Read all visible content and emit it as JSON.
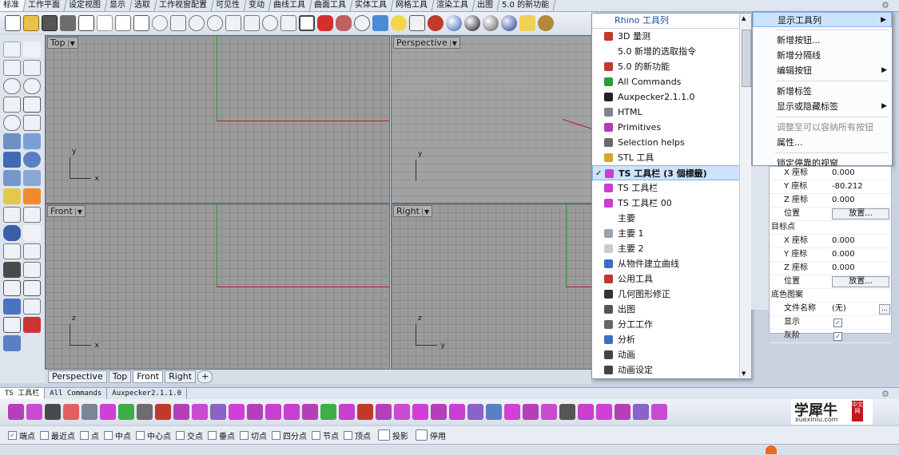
{
  "tabbar": {
    "tabs": [
      "标准",
      "工作平面",
      "设定视图",
      "显示",
      "选取",
      "工作视窗配置",
      "可见性",
      "变动",
      "曲线工具",
      "曲面工具",
      "实体工具",
      "网格工具",
      "渲染工具",
      "出图",
      "5.0 的新功能"
    ]
  },
  "viewports": {
    "top": "Top",
    "perspective": "Perspective",
    "front": "Front",
    "right": "Right",
    "axis_x": "x",
    "axis_y": "y",
    "axis_z": "z"
  },
  "viewport_tabs": [
    "Perspective",
    "Top",
    "Front",
    "Right",
    "+"
  ],
  "toolbar_list": {
    "header": "Rhino 工具列",
    "items": [
      {
        "label": "3D 量测",
        "color": "#c0392b"
      },
      {
        "label": "5.0 新增的选取指令",
        "color": ""
      },
      {
        "label": "5.0 的新功能",
        "color": "#c0392b"
      },
      {
        "label": "All Commands",
        "color": "#2e9b3b"
      },
      {
        "label": "Auxpecker2.1.1.0",
        "color": "#222222"
      },
      {
        "label": "HTML",
        "color": "#7a8597"
      },
      {
        "label": "Primitives",
        "color": "#b13ab8"
      },
      {
        "label": "Selection helps",
        "color": "#6a6a6a"
      },
      {
        "label": "STL 工具",
        "color": "#d8a431"
      },
      {
        "label": "TS 工具栏 (3 個標籤)",
        "color": "#c93fd0",
        "selected": true,
        "checked": "✓"
      },
      {
        "label": "TS 工具栏",
        "color": "#c93fd0"
      },
      {
        "label": "TS 工具栏 00",
        "color": "#c93fd0"
      },
      {
        "label": "主要",
        "color": ""
      },
      {
        "label": "主要 1",
        "color": "#9aa4b3"
      },
      {
        "label": "主要 2",
        "color": "#c8ccd3"
      },
      {
        "label": "从物件建立曲线",
        "color": "#3b6fbf"
      },
      {
        "label": "公用工具",
        "color": "#c0392b"
      },
      {
        "label": "几何图形修正",
        "color": "#333333"
      },
      {
        "label": "出图",
        "color": "#555555"
      },
      {
        "label": "分工工作",
        "color": "#666666"
      },
      {
        "label": "分析",
        "color": "#3b6fbf"
      },
      {
        "label": "动画",
        "color": "#444444"
      },
      {
        "label": "动画设定",
        "color": "#444444"
      }
    ]
  },
  "context_menu": {
    "show_toolbars": "显示工具列",
    "new_button": "新增按钮...",
    "new_separator": "新增分隔线",
    "edit_button": "编辑按钮",
    "new_tab": "新增标签",
    "show_hide_tabs": "显示或隐藏标签",
    "fit_buttons": "调整至可以容纳所有按钮",
    "properties": "属性...",
    "lock_docked": "锁定停靠的视窗"
  },
  "properties": {
    "x_label": "X 座标",
    "x1": "0.000",
    "y_label": "Y 座标",
    "y1": "-80.212",
    "z_label": "Z 座标",
    "z1": "0.000",
    "position": "位置",
    "place": "放置...",
    "target_section": "目标点",
    "x2": "0.000",
    "y2": "0.000",
    "z2": "0.000",
    "bg_section": "底色图案",
    "filename_label": "文件名称",
    "filename_value": "(无)",
    "browse": "...",
    "show_label": "显示",
    "gray_label": "灰阶",
    "check": "✓"
  },
  "bottom_tabs": [
    "TS 工具栏",
    "All Commands",
    "Auxpecker2.1.1.0"
  ],
  "logo": {
    "title": "学犀牛",
    "site": "xuexiniu.com",
    "badge": "中文网"
  },
  "osnap": {
    "items": [
      {
        "label": "端点",
        "checked": "✓"
      },
      {
        "label": "最近点",
        "checked": ""
      },
      {
        "label": "点",
        "checked": ""
      },
      {
        "label": "中点",
        "checked": ""
      },
      {
        "label": "中心点",
        "checked": ""
      },
      {
        "label": "交点",
        "checked": ""
      },
      {
        "label": "垂点",
        "checked": ""
      },
      {
        "label": "切点",
        "checked": ""
      },
      {
        "label": "四分点",
        "checked": ""
      },
      {
        "label": "节点",
        "checked": ""
      },
      {
        "label": "顶点",
        "checked": ""
      }
    ],
    "project": "投影",
    "disable": "停用"
  },
  "icons": [
    "gear-icon",
    "checkmark-icon",
    "submenu-arrow-icon",
    "scroll-up-icon",
    "scroll-down-icon"
  ]
}
